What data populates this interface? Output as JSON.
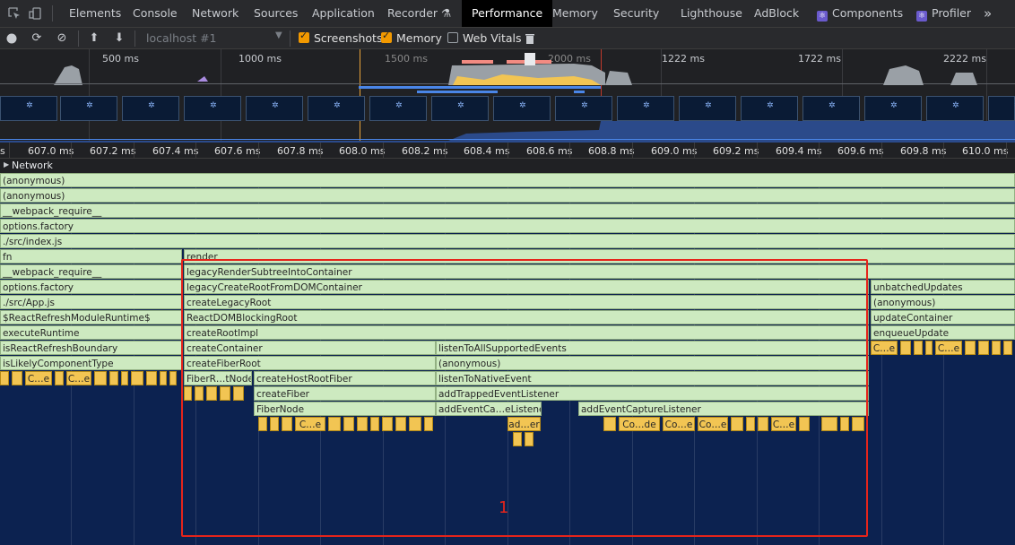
{
  "tabs": [
    {
      "label": "Elements"
    },
    {
      "label": "Console"
    },
    {
      "label": "Network"
    },
    {
      "label": "Sources"
    },
    {
      "label": "Application"
    },
    {
      "label": "Recorder ⚗"
    },
    {
      "label": "Performance"
    },
    {
      "label": "Memory"
    },
    {
      "label": "Security"
    },
    {
      "label": "Lighthouse"
    },
    {
      "label": "AdBlock"
    },
    {
      "label": "Components"
    },
    {
      "label": "Profiler"
    }
  ],
  "active_tab": "Performance",
  "more_tabs": "»",
  "toolbar": {
    "target": "localhost #1",
    "screenshots_label": "Screenshots",
    "memory_label": "Memory",
    "webvitals_label": "Web Vitals",
    "screenshots_checked": true,
    "memory_checked": true,
    "webvitals_checked": false
  },
  "overview_ticks": [
    "500 ms",
    "1000 ms",
    "1500 ms",
    "2000 ms",
    "1222 ms",
    "1722 ms",
    "2222 ms"
  ],
  "ruler_ticks": [
    "607.0 ms",
    "607.2 ms",
    "607.4 ms",
    "607.6 ms",
    "607.8 ms",
    "608.0 ms",
    "608.2 ms",
    "608.4 ms",
    "608.6 ms",
    "608.8 ms",
    "609.0 ms",
    "609.2 ms",
    "609.4 ms",
    "609.6 ms",
    "609.8 ms",
    "610.0 ms"
  ],
  "ruler_leading": "s",
  "network_label": "Network",
  "full_rows": [
    "(anonymous)",
    "(anonymous)",
    "__webpack_require__",
    "options.factory",
    "./src/index.js"
  ],
  "left_rows": [
    "fn",
    "__webpack_require__",
    "options.factory",
    "./src/App.js",
    "$ReactRefreshModuleRuntime$",
    "executeRuntime",
    "isReactRefreshBoundary",
    "isLikelyComponentType"
  ],
  "center_rows": [
    "render",
    "legacyRenderSubtreeIntoContainer",
    "legacyCreateRootFromDOMContainer",
    "createLegacyRoot",
    "ReactDOMBlockingRoot",
    "createRootImpl",
    "createContainer",
    "createFiberRoot"
  ],
  "right_rows": [
    "unbatchedUpdates",
    "(anonymous)",
    "updateContainer",
    "enqueueUpdate"
  ],
  "listen_rows": [
    "listenToAllSupportedEvents",
    "(anonymous)",
    "listenToNativeEvent",
    "addTrappedEventListener"
  ],
  "fiber_labels": {
    "fiber_root_node": "FiberR…tNode",
    "create_host_root_fiber": "createHostRootFiber",
    "create_fiber": "createFiber",
    "fiber_node": "FiberNode",
    "add_event_ca": "addEventCa…eListener",
    "add_event_capture": "addEventCaptureListener",
    "add_er": "ad…er"
  },
  "small_labels": {
    "c_e": "C…e",
    "co_de": "Co…de",
    "co_e": "Co…e"
  },
  "annotation": "1",
  "colors": {
    "accent": "#f29900",
    "green_bar": "#cdeac0",
    "yellow_bar": "#f2c553",
    "highlight": "#e5241b",
    "background": "#0c2250"
  }
}
